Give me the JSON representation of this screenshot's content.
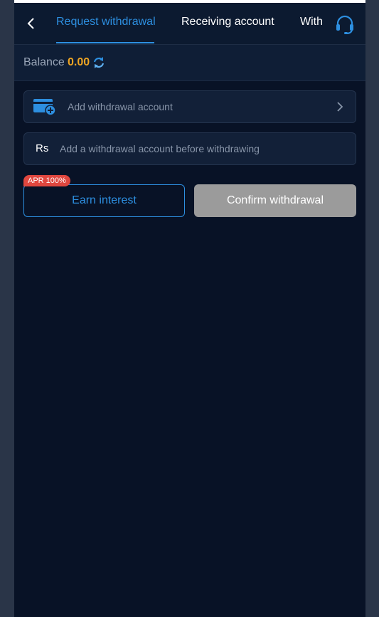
{
  "nav": {
    "tabs": [
      {
        "label": "Request withdrawal",
        "active": true
      },
      {
        "label": "Receiving account",
        "active": false
      },
      {
        "label": "With",
        "active": false
      }
    ],
    "back_icon": "chevron-left-icon",
    "support_icon": "headset-icon"
  },
  "balance": {
    "label": "Balance",
    "value": "0.00",
    "refresh_icon": "refresh-icon"
  },
  "withdrawal_account": {
    "label": "Add withdrawal account",
    "icon": "wallet-plus-icon",
    "arrow_icon": "chevron-right-icon"
  },
  "amount": {
    "currency_symbol": "Rs",
    "placeholder": "Add a withdrawal account before withdrawing",
    "value": ""
  },
  "actions": {
    "apr_badge": "APR 100%",
    "earn_label": "Earn interest",
    "confirm_label": "Confirm withdrawal"
  },
  "colors": {
    "page_bg": "#081226",
    "accent": "#2d8fe0",
    "balance_value": "#f0a623",
    "badge": "#e0473f",
    "confirm_disabled": "#9b9b9b"
  }
}
